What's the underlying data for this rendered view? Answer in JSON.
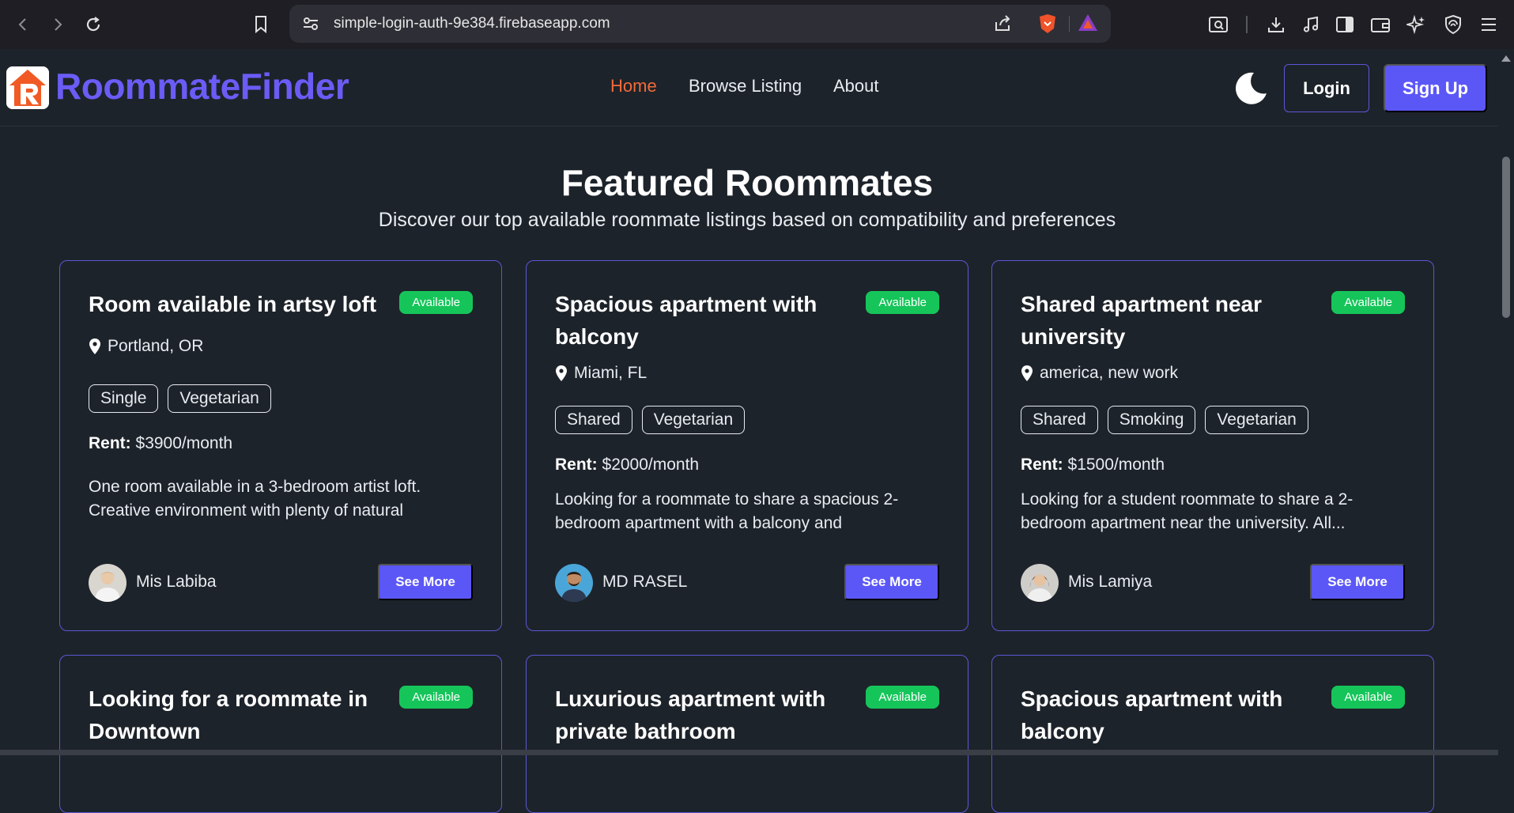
{
  "browser": {
    "url": "simple-login-auth-9e384.firebaseapp.com"
  },
  "nav": {
    "brand": "RoommateFinder",
    "links": [
      "Home",
      "Browse Listing",
      "About"
    ],
    "login": "Login",
    "signup": "Sign Up"
  },
  "hero": {
    "title": "Featured Roommates",
    "subtitle": "Discover our top available roommate listings based on compatibility and preferences"
  },
  "cards": [
    {
      "title": "Room available in artsy loft",
      "badge": "Available",
      "location": "Portland, OR",
      "tags": [
        "Single",
        "Vegetarian"
      ],
      "rent_label": "Rent:",
      "rent": "$3900/month",
      "description": "One room available in a 3-bedroom artist loft. Creative environment with plenty of natural",
      "owner": "Mis Labiba",
      "button": "See More"
    },
    {
      "title": "Spacious apartment with balcony",
      "badge": "Available",
      "location": "Miami, FL",
      "tags": [
        "Shared",
        "Vegetarian"
      ],
      "rent_label": "Rent:",
      "rent": "$2000/month",
      "description": "Looking for a roommate to share a spacious 2-bedroom apartment with a balcony and",
      "owner": "MD RASEL",
      "button": "See More"
    },
    {
      "title": "Shared apartment near university",
      "badge": "Available",
      "location": "america, new work",
      "tags": [
        "Shared",
        "Smoking",
        "Vegetarian"
      ],
      "rent_label": "Rent:",
      "rent": "$1500/month",
      "description": "Looking for a student roommate to share a 2-bedroom apartment near the university. All...",
      "owner": "Mis Lamiya",
      "button": "See More"
    },
    {
      "title": "Looking for a roommate in Downtown",
      "badge": "Available"
    },
    {
      "title": "Luxurious apartment with private bathroom",
      "badge": "Available"
    },
    {
      "title": "Spacious apartment with balcony",
      "badge": "Available"
    }
  ]
}
